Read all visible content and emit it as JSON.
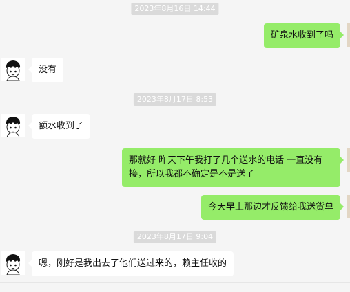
{
  "timestamps": [
    "2023年8月16日 14:44",
    "2023年8月17日 8:53",
    "2023年8月17日 9:04"
  ],
  "messages": [
    {
      "side": "right",
      "text": "矿泉水收到了吗"
    },
    {
      "side": "left",
      "text": "没有"
    },
    {
      "side": "left",
      "text": "额水收到了"
    },
    {
      "side": "right",
      "text": "那就好  昨天下午我打了几个送水的电话  一直没有接，所以我都不确定是不是送了"
    },
    {
      "side": "right",
      "text": "今天早上那边才反馈给我送货单"
    },
    {
      "side": "left",
      "text": "嗯，刚好是我出去了他们送过来的，赖主任收的"
    }
  ],
  "colors": {
    "background": "#f5f5f5",
    "bubble_out": "#95ec69",
    "bubble_in": "#ffffff",
    "timestamp_bg": "#dadada"
  },
  "icons": {
    "contact_avatar": "cartoon-boy-avatar",
    "self_avatar": "user-avatar"
  }
}
